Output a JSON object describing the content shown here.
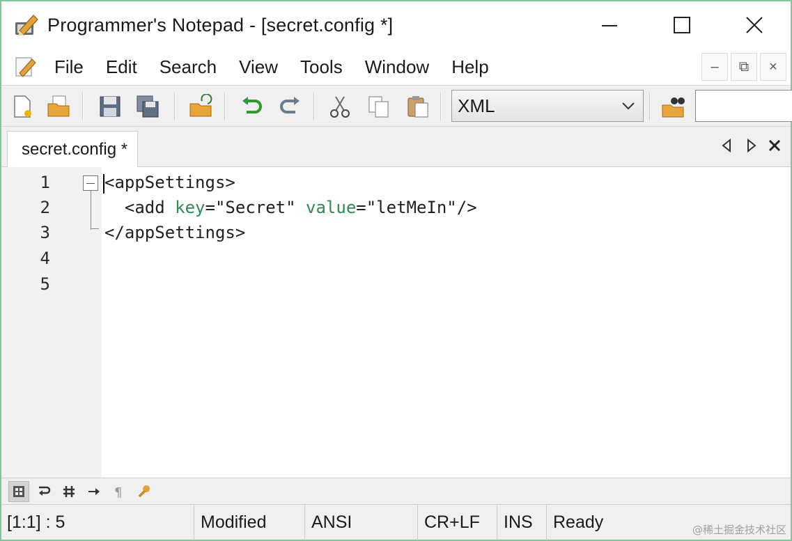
{
  "window": {
    "title": "Programmer's Notepad - [secret.config *]"
  },
  "menu": {
    "items": [
      "File",
      "Edit",
      "Search",
      "View",
      "Tools",
      "Window",
      "Help"
    ]
  },
  "toolbar": {
    "scheme_value": "XML",
    "find_value": ""
  },
  "tabs": [
    {
      "label": "secret.config *"
    }
  ],
  "editor": {
    "line_numbers": [
      "1",
      "2",
      "3",
      "4",
      "5"
    ],
    "lines": [
      {
        "tag_open": "<appSettings>"
      },
      {
        "prefix": "  <add ",
        "attr1": "key",
        "val1": "=\"Secret\" ",
        "attr2": "value",
        "val2": "=\"letMeIn\"/>"
      },
      {
        "tag_close": "</appSettings>"
      }
    ]
  },
  "statusbar": {
    "position": "[1:1] : 5",
    "modified": "Modified",
    "encoding": "ANSI",
    "line_ending": "CR+LF",
    "insert_mode": "INS",
    "state": "Ready"
  },
  "watermark": "@稀土掘金技术社区",
  "icons": {
    "app": "pencil-icon",
    "minimize": "minimize-icon",
    "maximize": "maximize-icon",
    "close": "close-icon"
  },
  "colors": {
    "attribute": "#2e8b57",
    "window_border": "#7ec89a"
  }
}
